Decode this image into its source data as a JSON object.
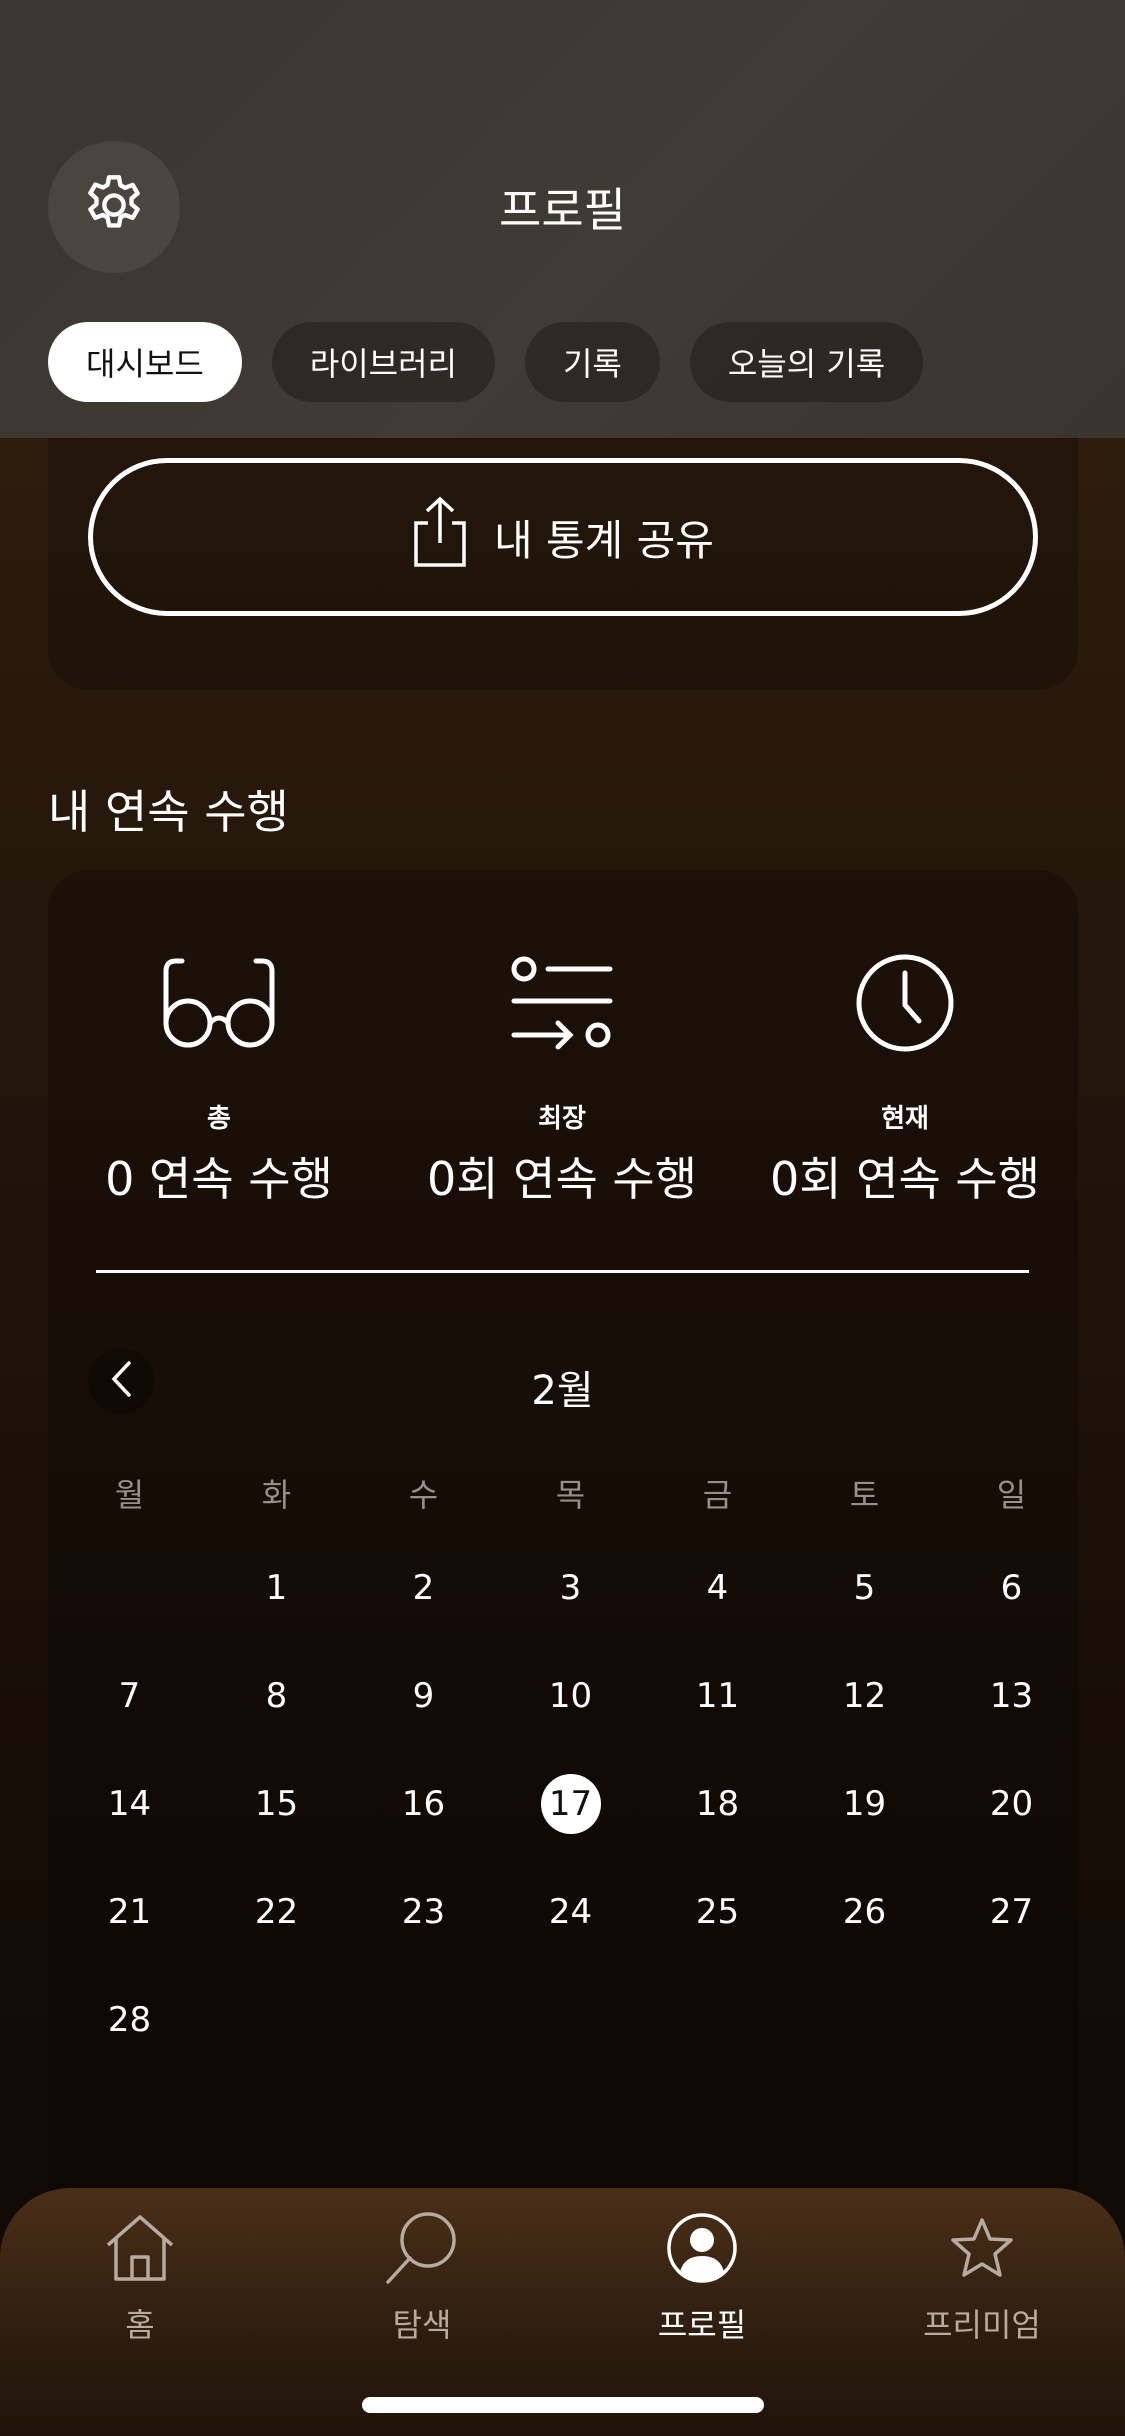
{
  "header": {
    "title": "프로필",
    "tabs": [
      {
        "label": "대시보드",
        "active": true
      },
      {
        "label": "라이브러리",
        "active": false
      },
      {
        "label": "기록",
        "active": false
      },
      {
        "label": "오늘의 기록",
        "active": false
      }
    ]
  },
  "share": {
    "label": "내 통계 공유",
    "icon": "share-icon"
  },
  "streak": {
    "section_title": "내 연속 수행",
    "stats": [
      {
        "icon": "glasses-icon",
        "label": "총",
        "value": "0 연속 수행"
      },
      {
        "icon": "list-sort-icon",
        "label": "최장",
        "value": "0회 연속 수행"
      },
      {
        "icon": "clock-icon",
        "label": "현재",
        "value": "0회 연속 수행"
      }
    ]
  },
  "calendar": {
    "month": "2월",
    "weekdays": [
      "월",
      "화",
      "수",
      "목",
      "금",
      "토",
      "일"
    ],
    "weeks": [
      [
        "",
        "1",
        "2",
        "3",
        "4",
        "5",
        "6"
      ],
      [
        "7",
        "8",
        "9",
        "10",
        "11",
        "12",
        "13"
      ],
      [
        "14",
        "15",
        "16",
        "17",
        "18",
        "19",
        "20"
      ],
      [
        "21",
        "22",
        "23",
        "24",
        "25",
        "26",
        "27"
      ],
      [
        "28",
        "",
        "",
        "",
        "",
        "",
        ""
      ]
    ],
    "today": "17"
  },
  "nav": {
    "items": [
      {
        "label": "홈",
        "icon": "home-icon",
        "active": false
      },
      {
        "label": "탐색",
        "icon": "search-icon",
        "active": false
      },
      {
        "label": "프로필",
        "icon": "profile-icon",
        "active": true
      },
      {
        "label": "프리미엄",
        "icon": "star-icon",
        "active": false
      }
    ]
  }
}
